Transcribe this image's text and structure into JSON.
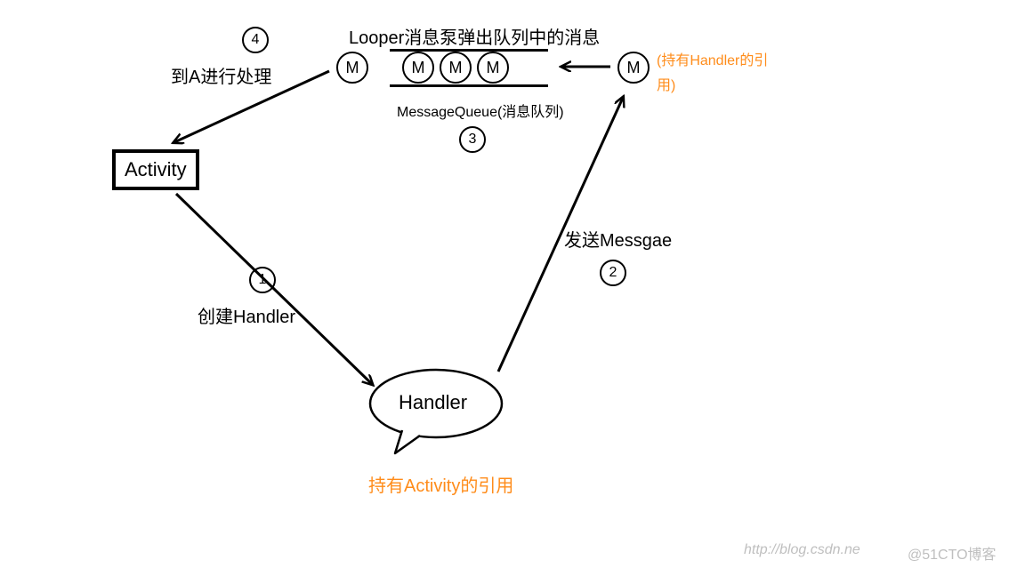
{
  "title_looper": "Looper消息泵弹出队列中的消息",
  "msgqueue_label": "MessageQueue(消息队列)",
  "activity_label": "Activity",
  "handler_label": "Handler",
  "handler_note": "持有Activity的引用",
  "m_note_line1": "(持有Handler的引",
  "m_note_line2": "用)",
  "step1_label": "创建Handler",
  "step2_label": "发送Messgae",
  "step4_label": "到A进行处理",
  "num1": "1",
  "num2": "2",
  "num3": "3",
  "num4": "4",
  "M": "M",
  "watermark_left": "http://blog.csdn.ne",
  "watermark_right": "@51CTO博客"
}
